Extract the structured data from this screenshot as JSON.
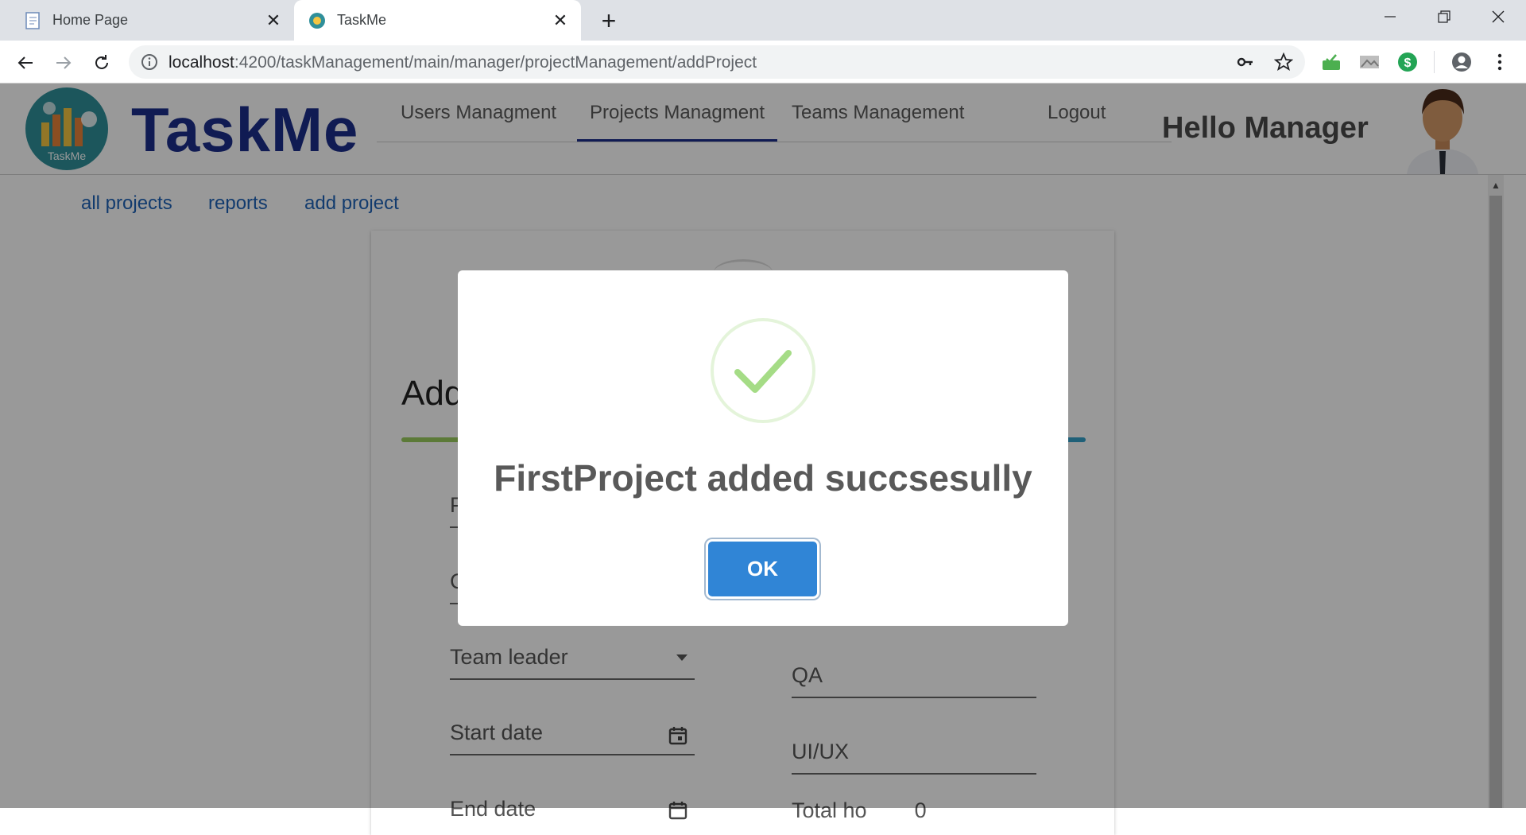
{
  "browser": {
    "tabs": [
      {
        "title": "Home Page",
        "active": false,
        "icon": "document-icon"
      },
      {
        "title": "TaskMe",
        "active": true,
        "icon": "taskme-favicon"
      }
    ],
    "url_host": "localhost",
    "url_rest": ":4200/taskManagement/main/manager/projectManagement/addProject"
  },
  "app": {
    "title": "TaskMe",
    "logo_text": "TaskMe",
    "nav": [
      "Users Managment",
      "Projects Managment",
      "Teams Management",
      "Logout"
    ],
    "active_nav": "Projects Managment",
    "greeting": "Hello Manager"
  },
  "subnav": [
    "all projects",
    "reports",
    "add project"
  ],
  "form": {
    "heading_partial": "Add",
    "fields_left_partial": [
      "P",
      "C"
    ],
    "team_leader_label": "Team leader",
    "start_date_label": "Start date",
    "end_date_label": "End date",
    "qa_label": "QA",
    "uiux_label": "UI/UX",
    "total_label_partial": "Total ho        0"
  },
  "dialog": {
    "message": "FirstProject added succsesully",
    "ok_label": "OK",
    "icon": "success-check-icon"
  },
  "colors": {
    "brand_blue": "#1b2d8a",
    "link_blue": "#1e63b8",
    "ok_button": "#3085d6",
    "success_green": "#a5dc86"
  }
}
